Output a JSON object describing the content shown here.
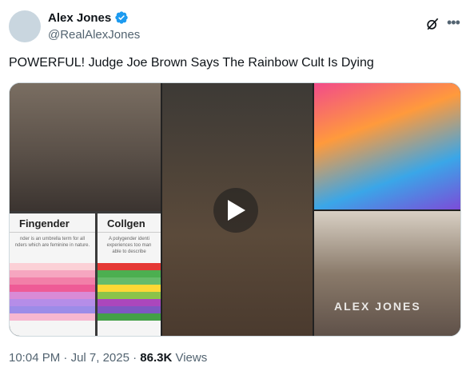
{
  "author": {
    "name": "Alex Jones",
    "handle": "@RealAlexJones"
  },
  "tweet": {
    "text": "POWERFUL! Judge Joe Brown Says The Rainbow Cult Is Dying"
  },
  "media": {
    "card_left_title": "Fingender",
    "card_left_desc": "nder is an umbrella term for all nders which are feminine in nature.",
    "card_right_title": "Collgen",
    "card_right_desc": "A polygender identi experiences too man able to describe",
    "watermark": "ALEX JONES"
  },
  "meta": {
    "time": "10:04 PM",
    "sep": " · ",
    "date": "Jul 7, 2025",
    "sep2": " · ",
    "views": "86.3K",
    "views_label": " Views"
  },
  "colors": {
    "verified": "#1d9bf0",
    "muted": "#536471"
  }
}
